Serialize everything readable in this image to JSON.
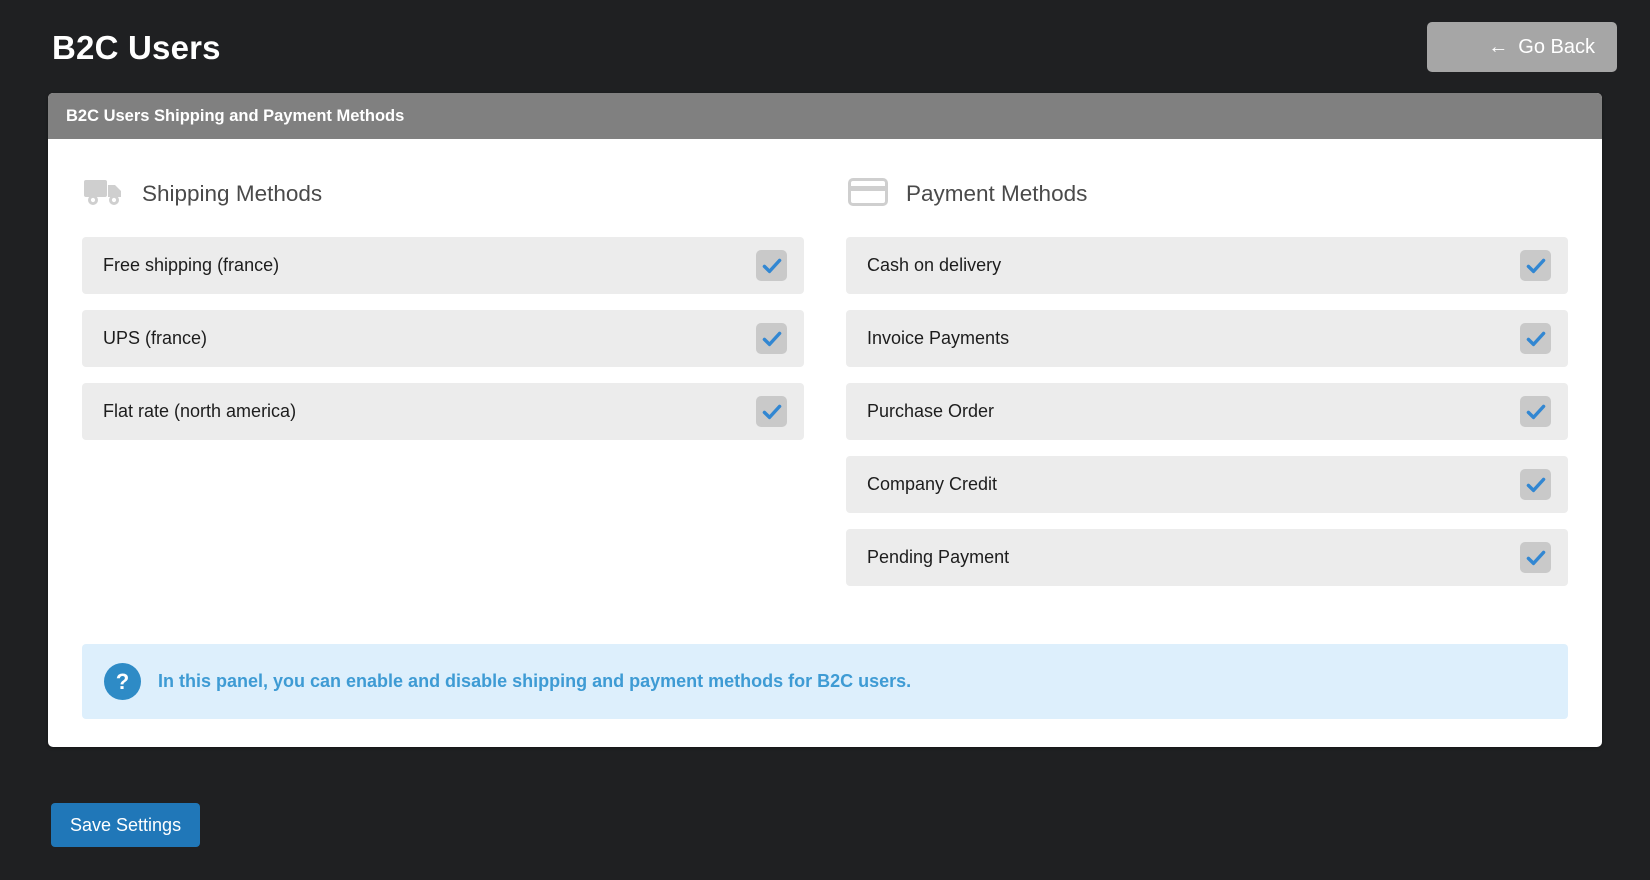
{
  "header": {
    "title": "B2C Users",
    "go_back_label": "Go Back",
    "go_back_arrow": "←",
    "go_back_icon": "arrow-left-icon"
  },
  "panel": {
    "header_title": "B2C Users Shipping and Payment Methods",
    "shipping": {
      "icon": "truck-icon",
      "title": "Shipping Methods",
      "items": [
        {
          "label": "Free shipping (france)",
          "checked": true
        },
        {
          "label": "UPS (france)",
          "checked": true
        },
        {
          "label": "Flat rate (north america)",
          "checked": true
        }
      ]
    },
    "payment": {
      "icon": "credit-card-icon",
      "title": "Payment Methods",
      "items": [
        {
          "label": "Cash on delivery",
          "checked": true
        },
        {
          "label": "Invoice Payments",
          "checked": true
        },
        {
          "label": "Purchase Order",
          "checked": true
        },
        {
          "label": "Company Credit",
          "checked": true
        },
        {
          "label": "Pending Payment",
          "checked": true
        }
      ]
    },
    "info": {
      "icon": "question-mark-icon",
      "icon_glyph": "?",
      "text": "In this panel, you can enable and disable shipping and payment methods for B2C users."
    }
  },
  "footer": {
    "save_label": "Save Settings"
  },
  "colors": {
    "page_background": "#1f2022",
    "panel_header": "#808080",
    "row_background": "#ececec",
    "checkbox_box": "#c9c9c9",
    "checkbox_tick": "#3287d2",
    "info_background": "#ddeffc",
    "info_text": "#3e9bd4",
    "save_button": "#2077b8",
    "go_back_button": "#a6a6a6"
  }
}
